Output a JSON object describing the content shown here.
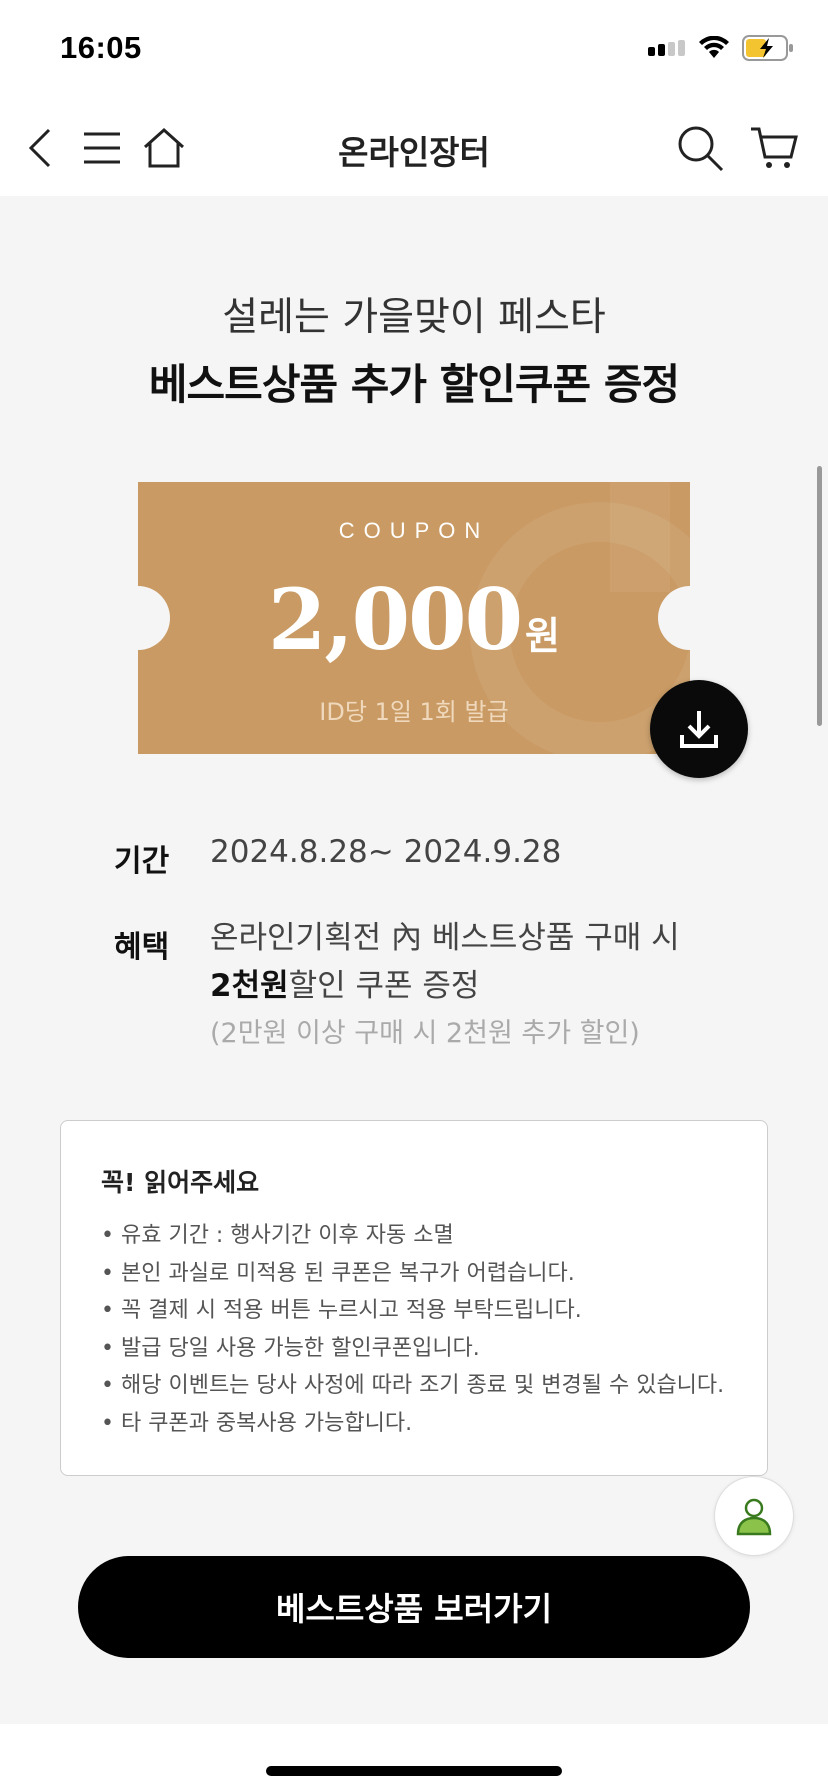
{
  "status_bar": {
    "time": "16:05"
  },
  "nav": {
    "title": "온라인장터"
  },
  "headline": {
    "subtitle": "설레는 가을맞이 페스타",
    "title": "베스트상품 추가 할인쿠폰 증정"
  },
  "coupon": {
    "label": "COUPON",
    "amount": "2,000",
    "unit": "원",
    "note": "ID당 1일 1회 발급",
    "color": "#c99a63"
  },
  "info": {
    "period_label": "기간",
    "period_value": "2024.8.28~ 2024.9.28",
    "benefit_label": "혜택",
    "benefit_line1": "온라인기획전 內 베스트상품 구매 시",
    "benefit_bold": "2천원",
    "benefit_line2_rest": "할인 쿠폰 증정",
    "benefit_note": "(2만원 이상 구매 시 2천원 추가 할인)"
  },
  "notice": {
    "title": "꼭! 읽어주세요",
    "items": [
      "유효 기간 : 행사기간 이후 자동 소멸",
      "본인 과실로 미적용 된 쿠폰은 복구가 어렵습니다.",
      "꼭 결제 시 적용 버튼 누르시고 적용 부탁드립니다.",
      "발급 당일 사용 가능한 할인쿠폰입니다.",
      "해당 이벤트는 당사 사정에 따라 조기 종료 및 변경될 수 있습니다.",
      "타 쿠폰과 중복사용 가능합니다."
    ]
  },
  "cta": {
    "label": "베스트상품 보러가기"
  },
  "icons": {
    "back": "chevron-left-icon",
    "menu": "hamburger-menu-icon",
    "home": "home-icon",
    "search": "search-icon",
    "cart": "cart-icon",
    "download": "download-icon",
    "profile": "user-icon"
  }
}
